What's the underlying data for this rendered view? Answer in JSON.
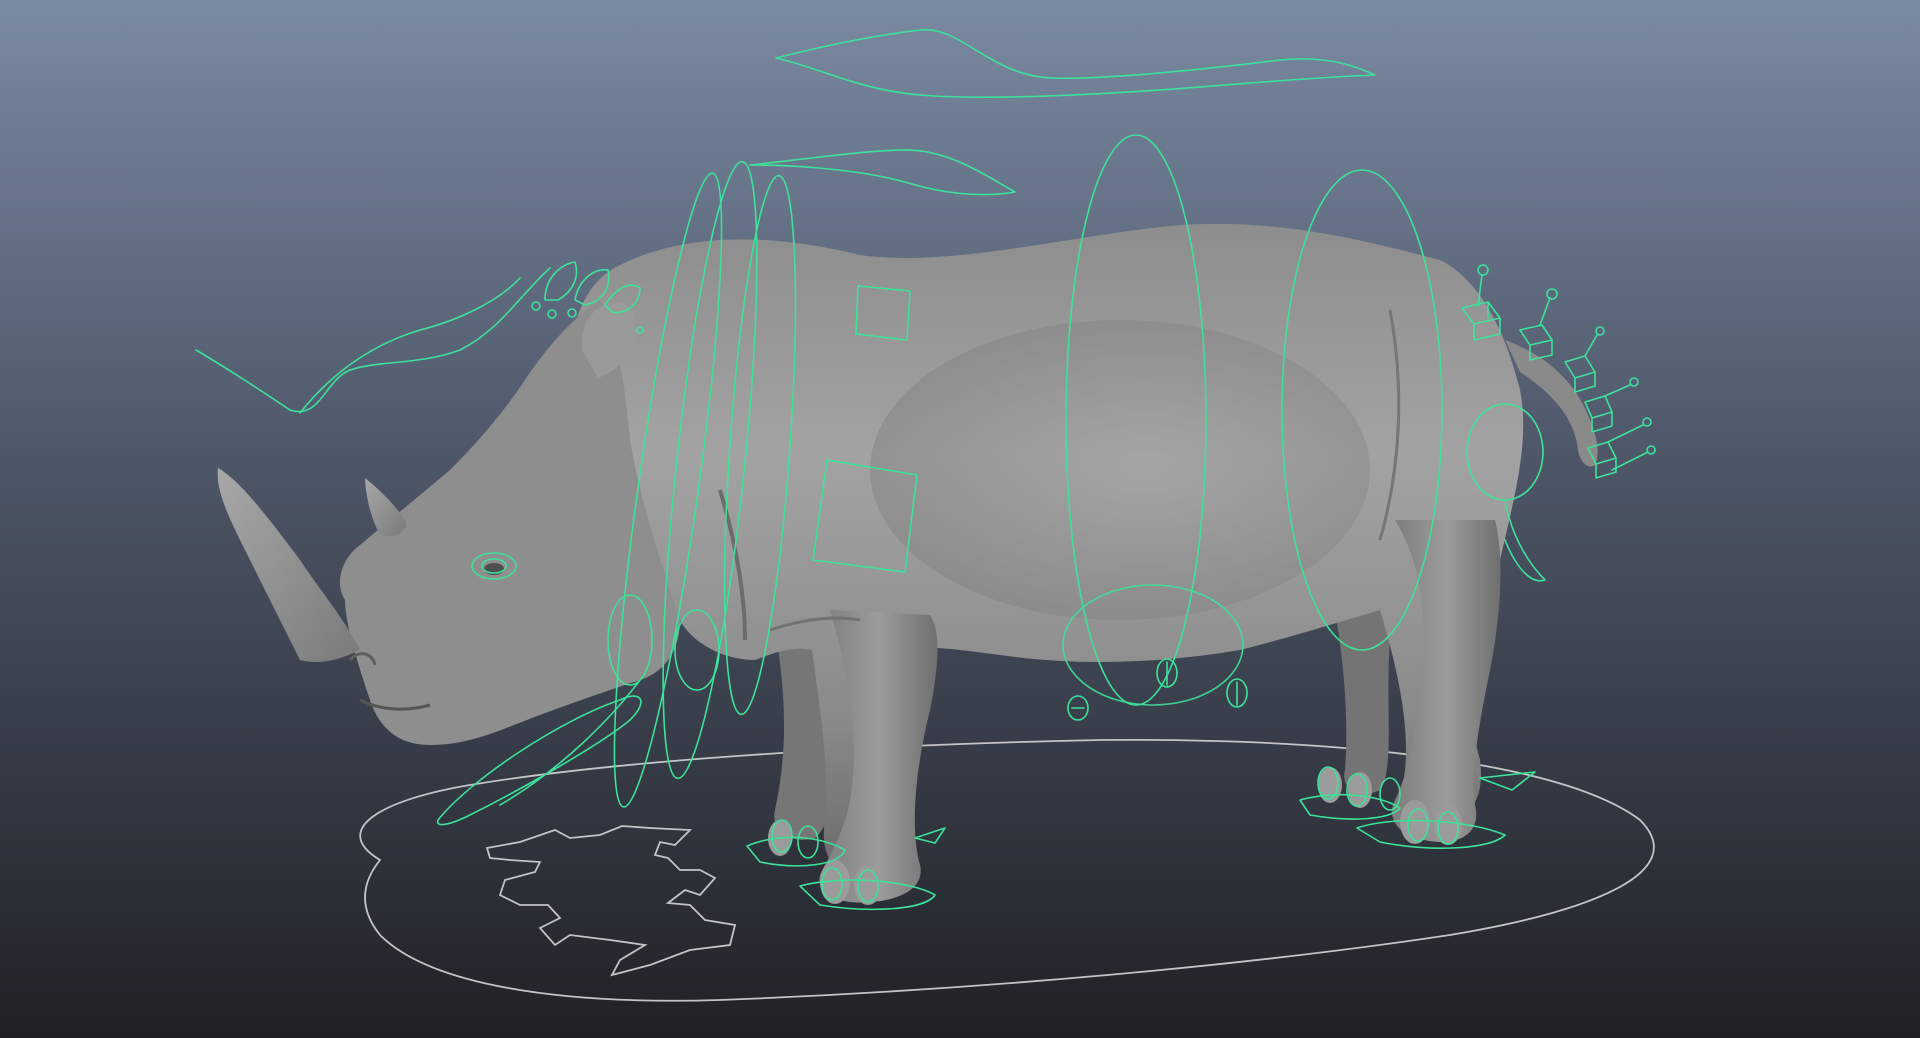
{
  "viewport": {
    "background_top": "#7a8aa2",
    "background_bottom": "#1f2126"
  },
  "colors": {
    "control_curve": "#3de29a",
    "world_control": "#c2c4c8",
    "mesh_light": "#a4a4a4",
    "mesh_mid": "#8b8b8b",
    "mesh_dark": "#5a5a5a"
  },
  "scene": {
    "model": "rhino-mesh",
    "controls": [
      "head-ik-curve",
      "ear-controls",
      "eye-control",
      "neck-ring-controls",
      "spine-ring-controls",
      "hip-control",
      "tail-fk-controls",
      "foot-controls",
      "toe-controls",
      "world-ground-control",
      "global-move-curves"
    ]
  }
}
